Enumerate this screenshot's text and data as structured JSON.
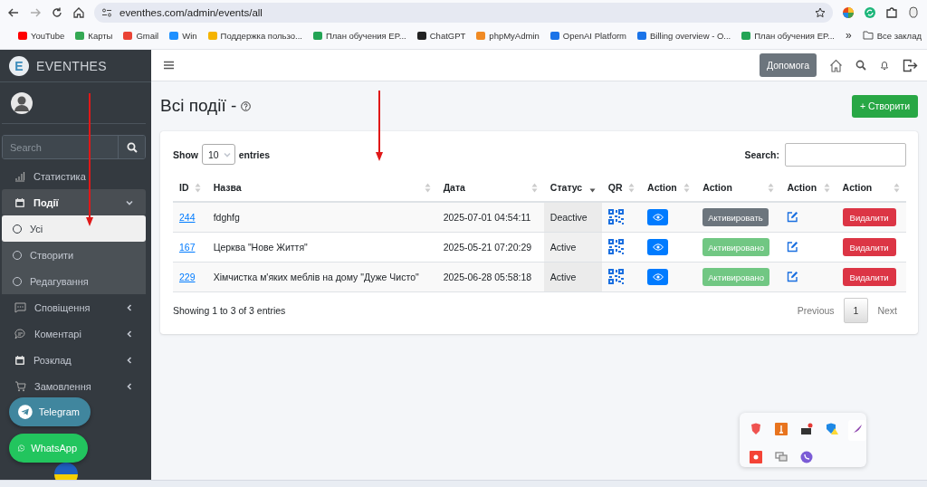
{
  "browser": {
    "url": "eventhes.com/admin/events/all",
    "bookmarks": [
      {
        "label": "YouTube",
        "color": "#ff0000"
      },
      {
        "label": "Карты",
        "color": "#34a853"
      },
      {
        "label": "Gmail",
        "color": "#ea4335"
      },
      {
        "label": "Win",
        "color": "#1e90ff"
      },
      {
        "label": "Поддержка пользо...",
        "color": "#f5b400"
      },
      {
        "label": "План обучения EP...",
        "color": "#23a455"
      },
      {
        "label": "ChatGPT",
        "color": "#222222"
      },
      {
        "label": "phpMyAdmin",
        "color": "#f08a24"
      },
      {
        "label": "OpenAI Platform",
        "color": "#1a73e8"
      },
      {
        "label": "Billing overview - O...",
        "color": "#1a73e8"
      },
      {
        "label": "План обучения EP...",
        "color": "#23a455"
      }
    ],
    "more": "»",
    "all_bookmarks": "Все заклад"
  },
  "sidebar": {
    "brand_letter": "E",
    "brand": "EVENTHES",
    "search_placeholder": "Search",
    "items": [
      {
        "label": "Статистика",
        "kind": "chart",
        "expanded": false,
        "has_children": false
      },
      {
        "label": "Події",
        "kind": "calendar",
        "expanded": true,
        "has_children": true,
        "children": [
          {
            "label": "Усі",
            "selected": true
          },
          {
            "label": "Створити",
            "selected": false
          },
          {
            "label": "Редагування",
            "selected": false
          }
        ]
      },
      {
        "label": "Сповіщення",
        "kind": "message",
        "expanded": false,
        "has_children": true
      },
      {
        "label": "Коментарі",
        "kind": "comment",
        "expanded": false,
        "has_children": true
      },
      {
        "label": "Розклад",
        "kind": "calendar",
        "expanded": false,
        "has_children": true
      },
      {
        "label": "Замовлення",
        "kind": "cart",
        "expanded": false,
        "has_children": true
      }
    ]
  },
  "floating_buttons": [
    {
      "label": "Telegram",
      "kind": "telegram"
    },
    {
      "label": "WhatsApp",
      "kind": "whatsapp"
    }
  ],
  "header": {
    "help_button": "Допомога"
  },
  "page": {
    "title": "Всі події -",
    "create_button": "+ Створити"
  },
  "table_controls": {
    "show_label": "Show",
    "page_size": "10",
    "entries_label": "entries",
    "search_label": "Search:"
  },
  "table": {
    "columns": [
      {
        "label": "ID",
        "sorted": false
      },
      {
        "label": "Назва",
        "sorted": false
      },
      {
        "label": "Дата",
        "sorted": false
      },
      {
        "label": "Статус",
        "sorted": true
      },
      {
        "label": "QR",
        "sorted": false
      },
      {
        "label": "Action",
        "sorted": false
      },
      {
        "label": "Action",
        "sorted": false
      },
      {
        "label": "Action",
        "sorted": false
      },
      {
        "label": "Action",
        "sorted": false
      }
    ],
    "rows": [
      {
        "id": "244",
        "name": "fdghfg",
        "date": "2025-07-01 04:54:11",
        "status": "Deactive",
        "activate_label": "Активировать",
        "activated": false,
        "delete_label": "Видалити"
      },
      {
        "id": "167",
        "name": "Церква \"Нове Життя\"",
        "date": "2025-05-21 07:20:29",
        "status": "Active",
        "activate_label": "Активировано",
        "activated": true,
        "delete_label": "Видалити"
      },
      {
        "id": "229",
        "name": "Хімчистка м'яких меблів на дому \"Дуже Чисто\"",
        "date": "2025-06-28 05:58:18",
        "status": "Active",
        "activate_label": "Активировано",
        "activated": true,
        "delete_label": "Видалити"
      }
    ]
  },
  "footer": {
    "info": "Showing 1 to 3 of 3 entries",
    "pages": [
      {
        "label": "Previous",
        "selected": false
      },
      {
        "label": "1",
        "selected": true
      },
      {
        "label": "Next",
        "selected": false
      }
    ]
  }
}
